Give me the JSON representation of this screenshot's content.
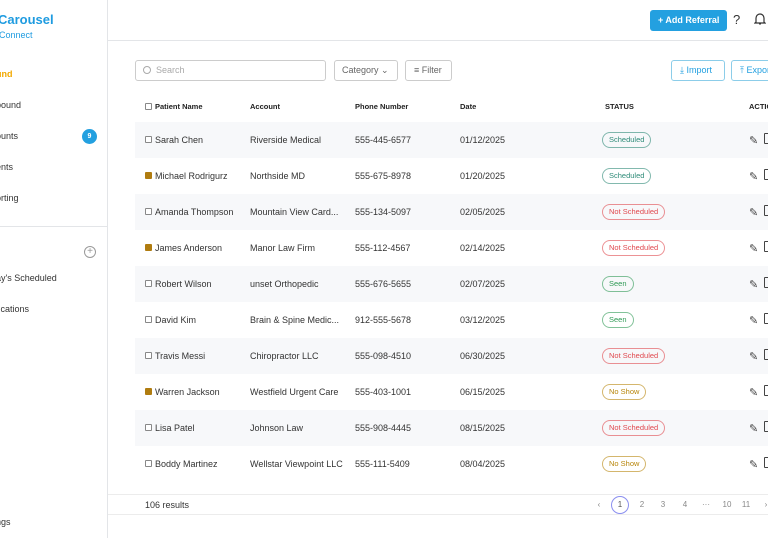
{
  "sidebar": {
    "brand": "Carousel",
    "subtitle": "Connect",
    "items": [
      {
        "label": "und"
      },
      {
        "label": "bound"
      },
      {
        "label": "ounts",
        "badge": "9"
      },
      {
        "label": "ents"
      },
      {
        "label": "orting"
      }
    ],
    "section_items": [
      {
        "label": "ay's Scheduled"
      },
      {
        "label": "fications"
      }
    ],
    "footer": "ngs"
  },
  "header": {
    "add_referral": "+ Add Referral",
    "help": "?"
  },
  "toolbar": {
    "search_placeholder": "Search",
    "category": "Category",
    "filter": "Filter",
    "import": "Import",
    "export": "Export"
  },
  "table": {
    "headers": [
      "Patient Name",
      "Account",
      "Phone Number",
      "Date",
      "STATUS",
      "ACTIONS"
    ],
    "rows": [
      {
        "checked": false,
        "name": "Sarah Chen",
        "account": "Riverside Medical",
        "phone": "555-445-6577",
        "date": "01/12/2025",
        "status": "Scheduled"
      },
      {
        "checked": true,
        "name": "Michael Rodrigurz",
        "account": "Northside MD",
        "phone": "555-675-8978",
        "date": "01/20/2025",
        "status": "Scheduled"
      },
      {
        "checked": false,
        "name": "Amanda Thompson",
        "account": "Mountain View Card...",
        "phone": "555-134-5097",
        "date": "02/05/2025",
        "status": "Not Scheduled"
      },
      {
        "checked": true,
        "name": "James Anderson",
        "account": "Manor Law Firm",
        "phone": "555-112-4567",
        "date": "02/14/2025",
        "status": "Not Scheduled"
      },
      {
        "checked": false,
        "name": "Robert Wilson",
        "account": "unset Orthopedic",
        "phone": "555-676-5655",
        "date": "02/07/2025",
        "status": "Seen"
      },
      {
        "checked": false,
        "name": "David Kim",
        "account": "Brain & Spine Medic...",
        "phone": "912-555-5678",
        "date": "03/12/2025",
        "status": "Seen"
      },
      {
        "checked": false,
        "name": "Travis Messi",
        "account": "Chiropractor LLC",
        "phone": "555-098-4510",
        "date": "06/30/2025",
        "status": "Not Scheduled"
      },
      {
        "checked": true,
        "name": "Warren Jackson",
        "account": "Westfield Urgent Care",
        "phone": "555-403-1001",
        "date": "06/15/2025",
        "status": "No Show"
      },
      {
        "checked": false,
        "name": "Lisa Patel",
        "account": "Johnson Law",
        "phone": "555-908-4445",
        "date": "08/15/2025",
        "status": "Not Scheduled"
      },
      {
        "checked": false,
        "name": "Boddy Martinez",
        "account": "Wellstar Viewpoint LLC",
        "phone": "555-111-5409",
        "date": "08/04/2025",
        "status": "No Show"
      }
    ]
  },
  "status_colors": {
    "Scheduled": "#2e8b78",
    "Not Scheduled": "#e0494f",
    "Seen": "#2f9a55",
    "No Show": "#b8860b"
  },
  "pagination": {
    "results": "106 results",
    "pages": [
      "1",
      "2",
      "3",
      "4",
      "···",
      "10",
      "11"
    ],
    "current": "1"
  }
}
